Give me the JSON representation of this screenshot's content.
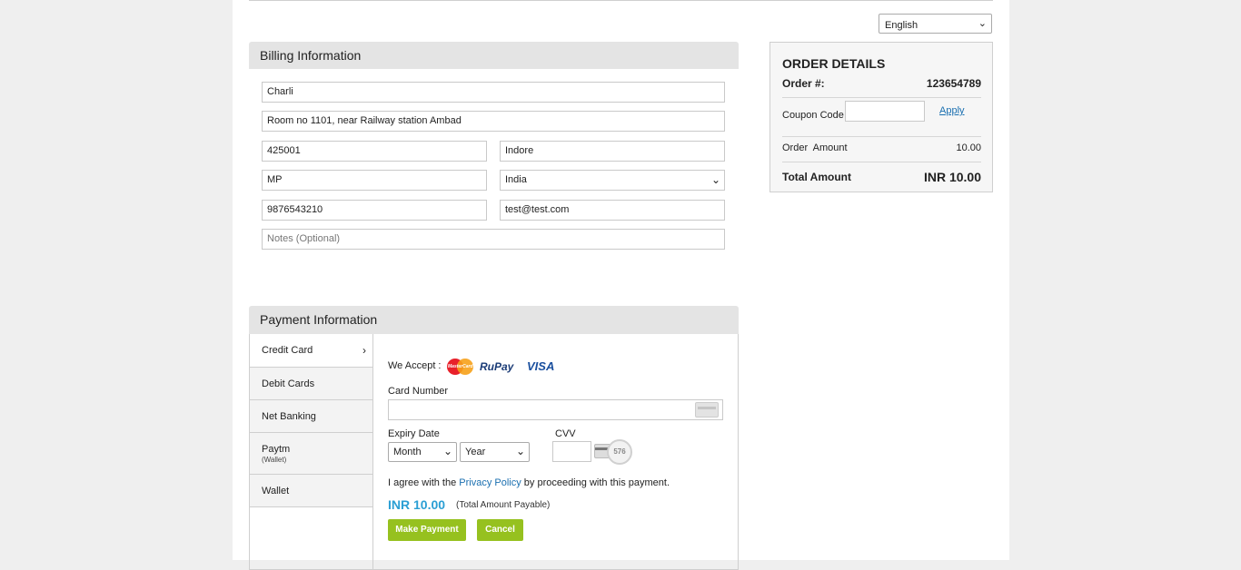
{
  "language": {
    "selected": "English"
  },
  "billing": {
    "title": "Billing Information",
    "name": "Charli",
    "address": "Room no 1101, near Railway station Ambad",
    "zip": "425001",
    "city": "Indore",
    "state": "MP",
    "country": "India",
    "phone": "9876543210",
    "email": "test@test.com",
    "notes_placeholder": "Notes (Optional)"
  },
  "order": {
    "title": "ORDER DETAILS",
    "order_label": "Order #:",
    "order_number": "123654789",
    "coupon_label": "Coupon Code",
    "apply_label": "Apply",
    "amount_label": "Order  Amount",
    "amount_value": "10.00",
    "total_label": "Total Amount",
    "total_value": "INR 10.00"
  },
  "payment": {
    "title": "Payment Information",
    "tabs": [
      {
        "label": "Credit Card",
        "sub": "",
        "active": true
      },
      {
        "label": "Debit Cards",
        "sub": ""
      },
      {
        "label": "Net Banking",
        "sub": ""
      },
      {
        "label": "Paytm",
        "sub": "(Wallet)"
      },
      {
        "label": "Wallet",
        "sub": ""
      }
    ],
    "we_accept": "We Accept :",
    "logos": {
      "mastercard": "MasterCard",
      "rupay_a": "RuPay",
      "rupay_b": "",
      "visa": "VISA"
    },
    "card_number_label": "Card Number",
    "expiry_label": "Expiry Date",
    "month": "Month",
    "year": "Year",
    "cvv_label": "CVV",
    "cvv_sample": "576",
    "agree_prefix": "I agree with the ",
    "privacy_link": "Privacy Policy",
    "agree_suffix": " by proceeding with this payment.",
    "amount": "INR 10.00",
    "amount_note": "(Total Amount Payable)",
    "make_payment": "Make Payment",
    "cancel": "Cancel"
  }
}
